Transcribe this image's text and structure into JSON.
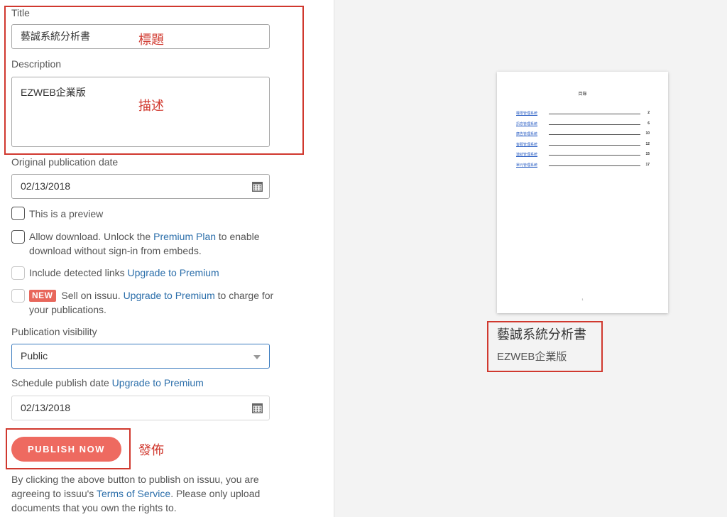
{
  "form": {
    "title_label": "Title",
    "title_value": "藝誠系統分析書",
    "description_label": "Description",
    "description_value": "EZWEB企業版",
    "orig_date_label": "Original publication date",
    "orig_date_value": "02/13/2018",
    "preview_checkbox_label": "This is a preview",
    "download_text_1": "Allow download. Unlock the ",
    "download_link": "Premium Plan",
    "download_text_2": " to enable download without sign-in from embeds.",
    "links_text": "Include detected links ",
    "links_link": "Upgrade to Premium",
    "sell_badge": "NEW",
    "sell_text_1": " Sell on issuu. ",
    "sell_link": "Upgrade to Premium",
    "sell_text_2": " to charge for your publications.",
    "visibility_label": "Publication visibility",
    "visibility_value": "Public",
    "schedule_label": "Schedule publish date ",
    "schedule_link": "Upgrade to Premium",
    "schedule_value": "02/13/2018",
    "publish_button": "PUBLISH NOW",
    "footer_text_1": "By clicking the above button to publish on issuu, you are agreeing to issuu's ",
    "footer_link": "Terms of Service",
    "footer_text_2": ". Please only upload documents that you own the rights to."
  },
  "annotations": {
    "title_note": "標題",
    "description_note": "描述",
    "publish_note": "發佈"
  },
  "preview": {
    "doc_heading": "目錄",
    "toc": [
      {
        "name": "權限管理系統",
        "page": "2"
      },
      {
        "name": "訊息管理系統",
        "page": "6"
      },
      {
        "name": "廣告管理系統",
        "page": "10"
      },
      {
        "name": "客服管理系統",
        "page": "12"
      },
      {
        "name": "連結管理系統",
        "page": "15"
      },
      {
        "name": "單元管理系統",
        "page": "17"
      }
    ],
    "page_number": "1",
    "title": "藝誠系統分析書",
    "description": "EZWEB企業版"
  },
  "colors": {
    "accent_button": "#ee6a60",
    "link": "#2b6eaa",
    "annotation": "#d0382e"
  },
  "icons": [
    "calendar-icon",
    "chevron-down-icon"
  ]
}
